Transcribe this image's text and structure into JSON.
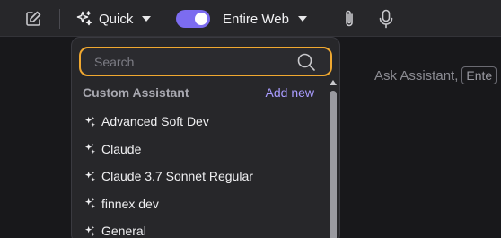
{
  "toolbar": {
    "edit_icon": "edit-icon",
    "quick_label": "Quick",
    "web_toggle_on": true,
    "web_label": "Entire Web",
    "attach_icon": "paperclip-icon",
    "mic_icon": "microphone-icon"
  },
  "hint": {
    "text": "Ask Assistant,",
    "key": "Ente"
  },
  "dropdown": {
    "search": {
      "placeholder": "Search",
      "value": ""
    },
    "section_title": "Custom Assistant",
    "add_new": "Add new",
    "items": [
      {
        "label": "Advanced Soft Dev"
      },
      {
        "label": "Claude"
      },
      {
        "label": "Claude 3.7 Sonnet Regular"
      },
      {
        "label": "finnex dev"
      },
      {
        "label": "General"
      }
    ]
  },
  "colors": {
    "accent": "#7c6cf0",
    "search_focus_border": "#f0a830",
    "add_new": "#a99cff"
  }
}
